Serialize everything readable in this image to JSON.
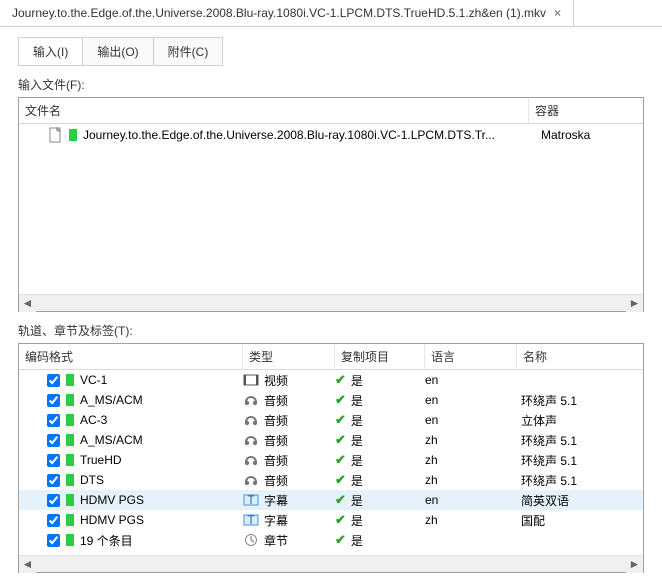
{
  "file_tab": {
    "title": "Journey.to.the.Edge.of.the.Universe.2008.Blu-ray.1080i.VC-1.LPCM.DTS.TrueHD.5.1.zh&en (1).mkv"
  },
  "sub_tabs": {
    "input": "输入(I)",
    "output": "输出(O)",
    "attachments": "附件(C)"
  },
  "labels": {
    "input_files": "输入文件(F):",
    "tracks_chapters_tags": "轨道、章节及标签(T):"
  },
  "files_table": {
    "headers": {
      "filename": "文件名",
      "container": "容器"
    },
    "rows": [
      {
        "filename": "Journey.to.the.Edge.of.the.Universe.2008.Blu-ray.1080i.VC-1.LPCM.DTS.Tr...",
        "container": "Matroska"
      }
    ]
  },
  "tracks_table": {
    "headers": {
      "codec": "编码格式",
      "type": "类型",
      "copy": "复制项目",
      "lang": "语言",
      "name": "名称"
    },
    "yes": "是",
    "rows": [
      {
        "codec": "VC-1",
        "type": "视频",
        "type_icon": "video",
        "lang": "en",
        "name": "",
        "sel": false
      },
      {
        "codec": "A_MS/ACM",
        "type": "音频",
        "type_icon": "audio",
        "lang": "en",
        "name": "环绕声 5.1",
        "sel": false
      },
      {
        "codec": "AC-3",
        "type": "音频",
        "type_icon": "audio",
        "lang": "en",
        "name": "立体声",
        "sel": false
      },
      {
        "codec": "A_MS/ACM",
        "type": "音频",
        "type_icon": "audio",
        "lang": "zh",
        "name": "环绕声 5.1",
        "sel": false
      },
      {
        "codec": "TrueHD",
        "type": "音频",
        "type_icon": "audio",
        "lang": "zh",
        "name": "环绕声 5.1",
        "sel": false
      },
      {
        "codec": "DTS",
        "type": "音频",
        "type_icon": "audio",
        "lang": "zh",
        "name": "环绕声 5.1",
        "sel": false
      },
      {
        "codec": "HDMV PGS",
        "type": "字幕",
        "type_icon": "subtitle",
        "lang": "en",
        "name": "简英双语",
        "sel": true
      },
      {
        "codec": "HDMV PGS",
        "type": "字幕",
        "type_icon": "subtitle",
        "lang": "zh",
        "name": "国配",
        "sel": false
      },
      {
        "codec": "19 个条目",
        "type": "章节",
        "type_icon": "chapter",
        "lang": "",
        "name": "",
        "sel": false
      }
    ]
  }
}
